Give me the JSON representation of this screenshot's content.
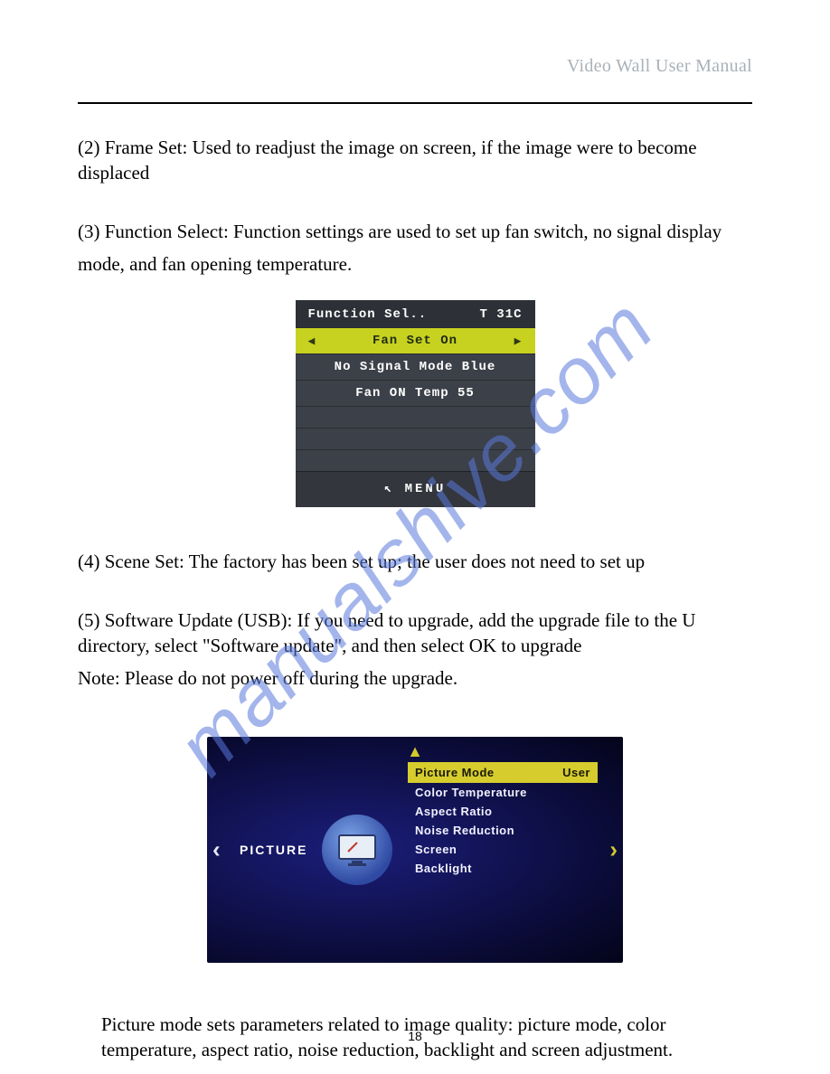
{
  "header": {
    "title": "Video Wall User Manual"
  },
  "paragraphs": {
    "p2": "(2) Frame Set: Used to readjust the image on screen, if the image were to become displaced",
    "p3a": "(3) Function Select: Function settings are used to set up fan switch, no signal display",
    "p3b": "mode, and fan opening temperature.",
    "p4": "(4) Scene Set: The factory has been set up; the user does not need to set up",
    "p5": "(5) Software Update (USB): If you need to upgrade, add the upgrade file to the U directory, select \"Software update\", and then select OK to upgrade",
    "p5note": "Note: Please do not power off during the upgrade.",
    "closing": "Picture mode sets parameters related to image quality: picture mode, color temperature, aspect ratio, noise reduction, backlight and screen adjustment."
  },
  "menu1": {
    "title_left": "Function Sel..",
    "title_right": "T 31C",
    "selected": "Fan Set On",
    "items": [
      "No Signal Mode Blue",
      "Fan ON Temp 55"
    ],
    "footer_icon": "↖",
    "footer": "MENU"
  },
  "menu2": {
    "section": "PICTURE",
    "selected_label": "Picture Mode",
    "selected_value": "User",
    "items": [
      "Color Temperature",
      "Aspect Ratio",
      "Noise Reduction",
      "Screen",
      "Backlight"
    ]
  },
  "watermark": "manualshive.com",
  "page_number": "18"
}
